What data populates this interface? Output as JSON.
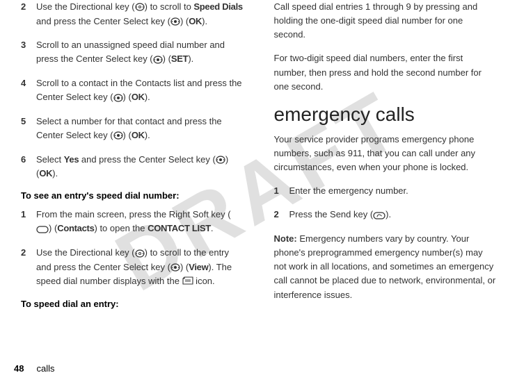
{
  "watermark": "DRAFT",
  "left": {
    "steps_a": [
      {
        "num": "2",
        "pre": "Use the Directional key (",
        "mid1": ") to scroll to ",
        "speed": "Speed Dials",
        "mid2": " and press the Center Select key (",
        "mid3": ") (",
        "ok": "OK",
        "post": ")."
      },
      {
        "num": "3",
        "text1": "Scroll to an unassigned speed dial number and press the Center Select key (",
        "text2": ") (",
        "set": "SET",
        "text3": ")."
      },
      {
        "num": "4",
        "text1": "Scroll to a contact in the Contacts list and press the Center Select key (",
        "text2": ") (",
        "ok": "OK",
        "text3": ")."
      },
      {
        "num": "5",
        "text1": "Select a number for that contact and press the Center Select key (",
        "text2": ") (",
        "ok": "OK",
        "text3": ")."
      },
      {
        "num": "6",
        "pre": "Select ",
        "yes": "Yes",
        "mid": " and press the Center Select key (",
        "mid2": ") (",
        "ok": "OK",
        "post": ")."
      }
    ],
    "subhead1_pre": "To see an entry's speed dial number",
    "subhead1_post": ":",
    "steps_b": [
      {
        "num": "1",
        "t1": "From the main screen, press the Right Soft key (",
        "t2": ") (",
        "contacts": "Contacts",
        "t3": ") to open the ",
        "clist": "CONTACT LIST",
        "t4": "."
      },
      {
        "num": "2",
        "t1": "Use the Directional key (",
        "t2": ") to scroll to the entry and press the Center Select key (",
        "t3": ") (",
        "view": "View",
        "t4": "). The speed dial number displays with the ",
        "t5": " icon."
      }
    ],
    "subhead2_pre": "To speed dial an entry",
    "subhead2_post": ":"
  },
  "right": {
    "p1": "Call speed dial entries 1 through 9 by pressing and holding the one-digit speed dial number for one second.",
    "p2": "For two-digit speed dial numbers, enter the first number, then press and hold the second number for one second.",
    "h2": "emergency calls",
    "p3": "Your service provider programs emergency phone numbers, such as 911, that you can call under any circumstances, even when your phone is locked.",
    "steps": [
      {
        "num": "1",
        "text": "Enter the emergency number."
      },
      {
        "num": "2",
        "pre": "Press the Send key (",
        "post": ")."
      }
    ],
    "note_label": "Note:",
    "note_text": " Emergency numbers vary by country. Your phone's preprogrammed emergency number(s) may not work in all locations, and sometimes an emergency call cannot be placed due to network, environmental, or interference issues."
  },
  "footer": {
    "page": "48",
    "section": "calls"
  }
}
